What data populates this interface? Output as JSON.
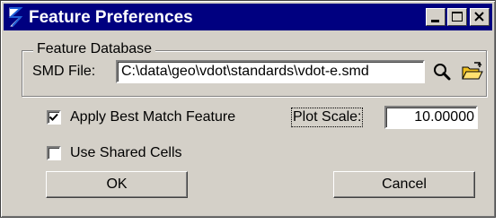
{
  "window": {
    "title": "Feature Preferences"
  },
  "feature_database": {
    "legend": "Feature Database",
    "smd_label": "SMD File:",
    "smd_value": "C:\\data\\geo\\vdot\\standards\\vdot-e.smd"
  },
  "options": {
    "apply_best_match": {
      "label": "Apply Best Match Feature",
      "checked": true
    },
    "use_shared_cells": {
      "label": "Use Shared Cells",
      "checked": false
    }
  },
  "plot_scale": {
    "label": "Plot Scale:",
    "value": "10.00000"
  },
  "buttons": {
    "ok": "OK",
    "cancel": "Cancel"
  },
  "icons": [
    "app-icon",
    "minimize-icon",
    "maximize-icon",
    "close-icon",
    "search-icon",
    "open-folder-icon",
    "checkmark-icon"
  ],
  "colors": {
    "titlebar": "#000080",
    "face": "#d4d0c8"
  }
}
